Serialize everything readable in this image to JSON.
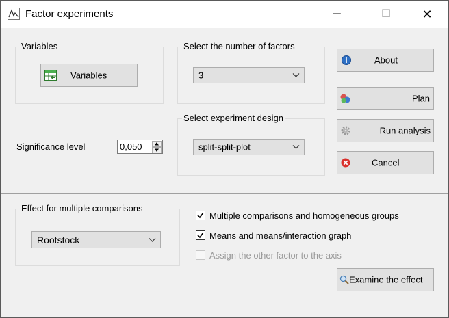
{
  "window": {
    "title": "Factor experiments",
    "controls": {
      "minimize": "─",
      "maximize": "☐",
      "close": "✕"
    }
  },
  "variables_group": {
    "label": "Variables",
    "button_label": "Variables"
  },
  "factors_group": {
    "label": "Select the number of factors",
    "selected": "3"
  },
  "design_group": {
    "label": "Select experiment design",
    "selected": "split-split-plot"
  },
  "significance": {
    "label": "Significance level",
    "value": "0,050"
  },
  "actions": {
    "about": "About",
    "plan": "Plan",
    "run_analysis": "Run analysis",
    "cancel": "Cancel"
  },
  "comparisons_group": {
    "label": "Effect for multiple comparisons",
    "selected": "Rootstock"
  },
  "options": [
    {
      "label": "Multiple comparisons and homogeneous groups",
      "checked": true,
      "enabled": true
    },
    {
      "label": "Means and means/interaction graph",
      "checked": true,
      "enabled": true
    },
    {
      "label": "Assign the other factor to the axis",
      "checked": false,
      "enabled": false
    }
  ],
  "examine_button": "Examine the effect",
  "colors": {
    "accent_blue": "#2d6fc4",
    "cancel_red": "#d9302c",
    "check_mark": "#000000"
  }
}
